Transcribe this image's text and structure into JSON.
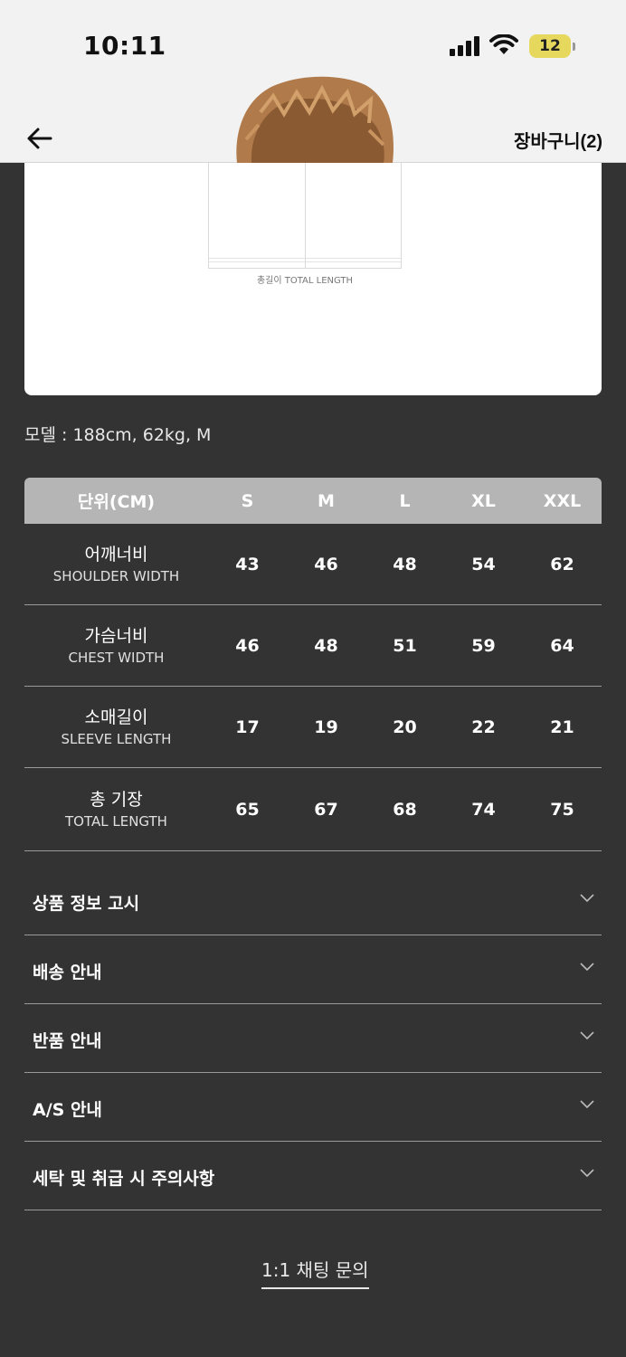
{
  "status_bar": {
    "time": "10:11",
    "battery": "12"
  },
  "header": {
    "cart_label": "장바구니(2)"
  },
  "diagram": {
    "total_length_label": "총길이 TOTAL LENGTH"
  },
  "model_info": "모델 : 188cm, 62kg, M",
  "size_table": {
    "columns": [
      "단위(CM)",
      "S",
      "M",
      "L",
      "XL",
      "XXL"
    ],
    "rows": [
      {
        "ko": "어깨너비",
        "en": "SHOULDER WIDTH",
        "values": [
          "43",
          "46",
          "48",
          "54",
          "62"
        ]
      },
      {
        "ko": "가슴너비",
        "en": "CHEST WIDTH",
        "values": [
          "46",
          "48",
          "51",
          "59",
          "64"
        ]
      },
      {
        "ko": "소매길이",
        "en": "SLEEVE LENGTH",
        "values": [
          "17",
          "19",
          "20",
          "22",
          "21"
        ]
      },
      {
        "ko": "총 기장",
        "en": "TOTAL LENGTH",
        "values": [
          "65",
          "67",
          "68",
          "74",
          "75"
        ]
      }
    ]
  },
  "accordion": [
    {
      "label": "상품 정보 고시"
    },
    {
      "label": "배송 안내"
    },
    {
      "label": "반품 안내"
    },
    {
      "label": "A/S 안내"
    },
    {
      "label": "세탁 및 취급 시 주의사항"
    }
  ],
  "chat_link": "1:1 채팅 문의",
  "colors": {
    "background": "#333333",
    "header_bg": "#f2f2f2",
    "table_header": "#b5b5b5",
    "battery": "#e6d85c"
  }
}
